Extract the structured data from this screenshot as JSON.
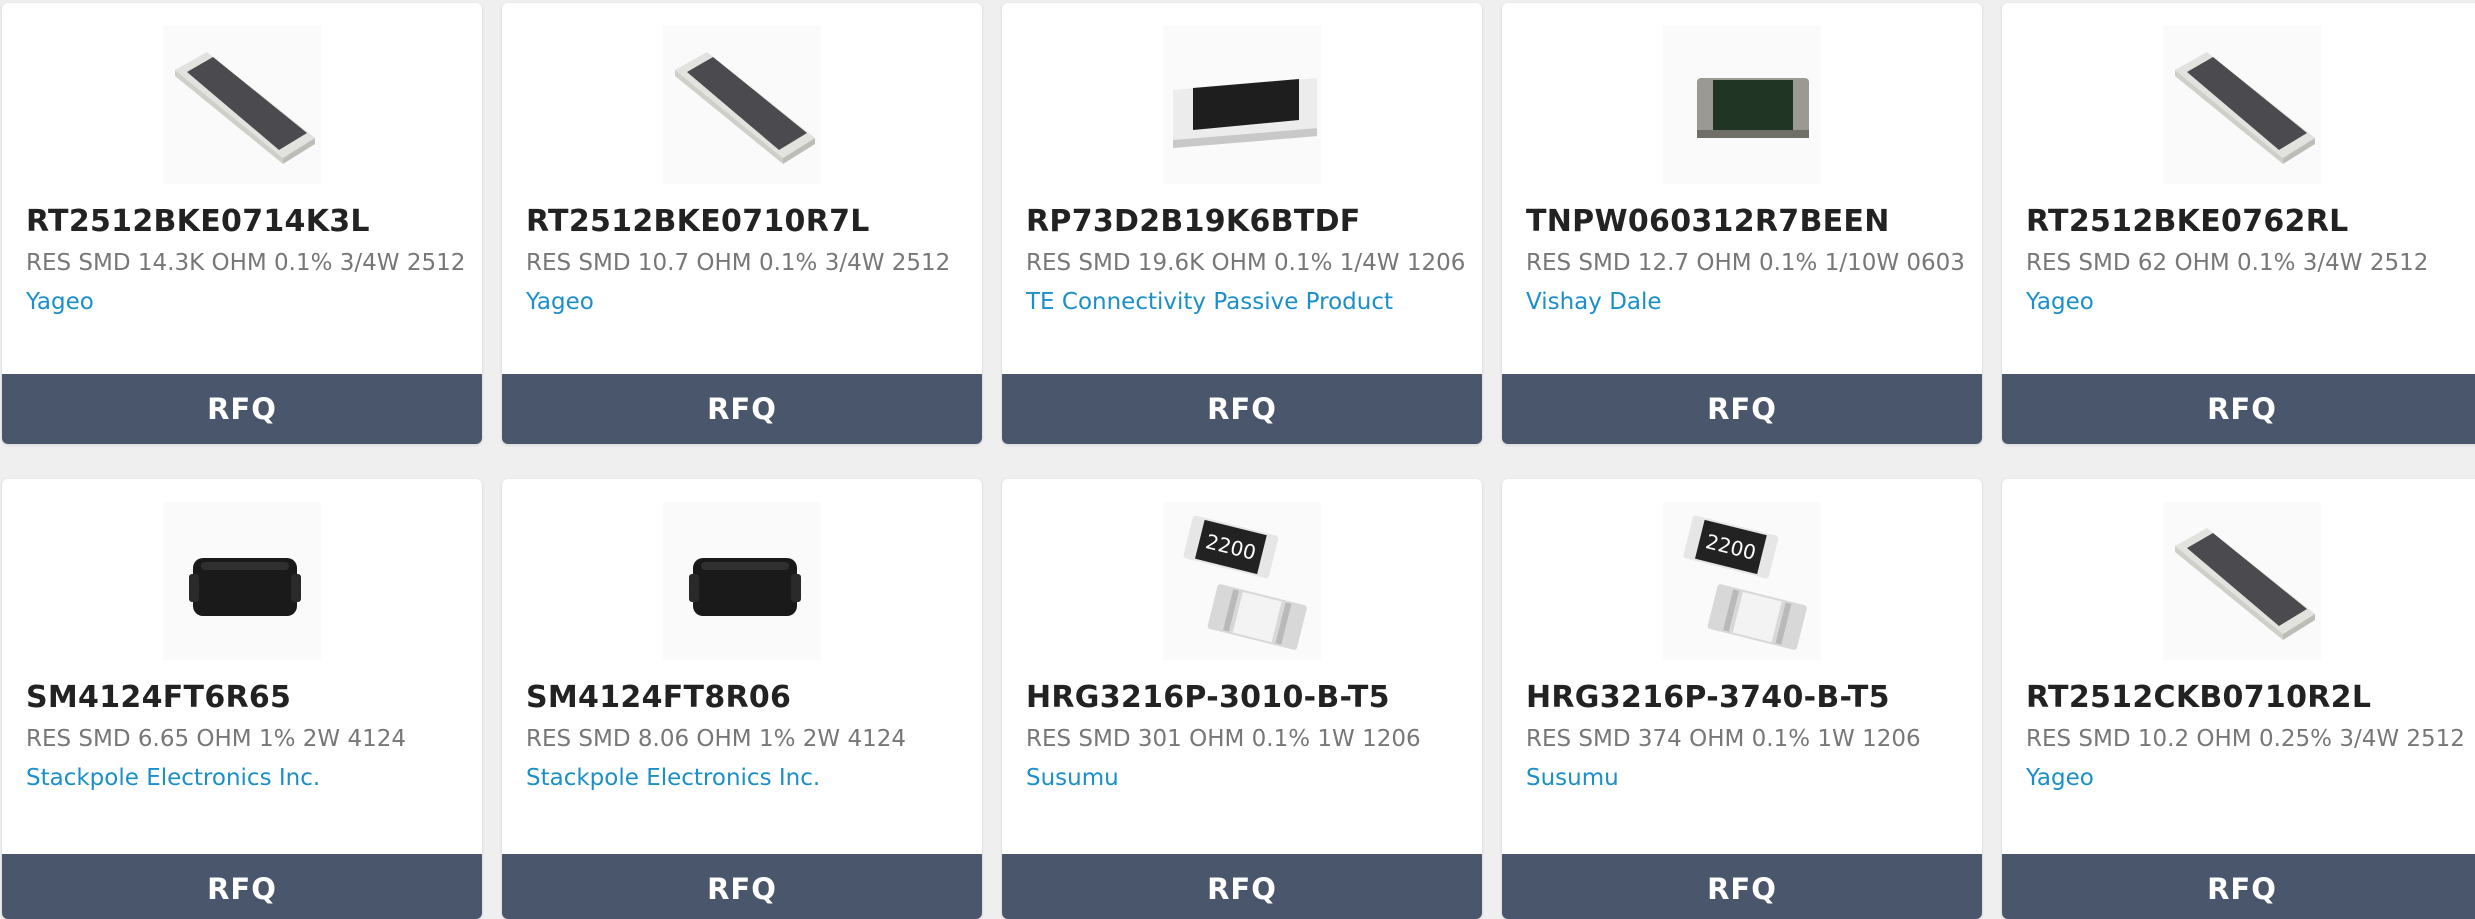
{
  "products": [
    {
      "part": "RT2512BKE0714K3L",
      "desc": "RES SMD 14.3K OHM 0.1% 3/4W 2512",
      "mfr": "Yageo",
      "image": "thin-film-chip-resistor-image",
      "button": "RFQ"
    },
    {
      "part": "RT2512BKE0710R7L",
      "desc": "RES SMD 10.7 OHM 0.1% 3/4W 2512",
      "mfr": "Yageo",
      "image": "thin-film-chip-resistor-image",
      "button": "RFQ"
    },
    {
      "part": "RP73D2B19K6BTDF",
      "desc": "RES SMD 19.6K OHM 0.1% 1/4W 1206",
      "mfr": "TE Connectivity Passive Product",
      "image": "black-chip-resistor-image",
      "button": "RFQ"
    },
    {
      "part": "TNPW060312R7BEEN",
      "desc": "RES SMD 12.7 OHM 0.1% 1/10W 0603",
      "mfr": "Vishay Dale",
      "image": "green-chip-resistor-image",
      "button": "RFQ"
    },
    {
      "part": "RT2512BKE0762RL",
      "desc": "RES SMD 62 OHM 0.1% 3/4W 2512",
      "mfr": "Yageo",
      "image": "thin-film-chip-resistor-image",
      "button": "RFQ"
    },
    {
      "part": "SM4124FT6R65",
      "desc": "RES SMD 6.65 OHM 1% 2W 4124",
      "mfr": "Stackpole Electronics Inc.",
      "image": "molded-resistor-image",
      "button": "RFQ"
    },
    {
      "part": "SM4124FT8R06",
      "desc": "RES SMD 8.06 OHM 1% 2W 4124",
      "mfr": "Stackpole Electronics Inc.",
      "image": "molded-resistor-image",
      "button": "RFQ"
    },
    {
      "part": "HRG3216P-3010-B-T5",
      "desc": "RES SMD 301 OHM 0.1% 1W 1206",
      "mfr": "Susumu",
      "image": "marked-chip-resistor-pair-image",
      "marking": "2200",
      "button": "RFQ"
    },
    {
      "part": "HRG3216P-3740-B-T5",
      "desc": "RES SMD 374 OHM 0.1% 1W 1206",
      "mfr": "Susumu",
      "image": "marked-chip-resistor-pair-image",
      "marking": "2200",
      "button": "RFQ"
    },
    {
      "part": "RT2512CKB0710R2L",
      "desc": "RES SMD 10.2 OHM 0.25% 3/4W 2512",
      "mfr": "Yageo",
      "image": "thin-film-chip-resistor-image",
      "button": "RFQ"
    }
  ],
  "colors": {
    "page_bg": "#efefef",
    "button_bg": "#4a566b",
    "manufacturer_link": "#1a8fc9",
    "description_text": "#777777"
  }
}
